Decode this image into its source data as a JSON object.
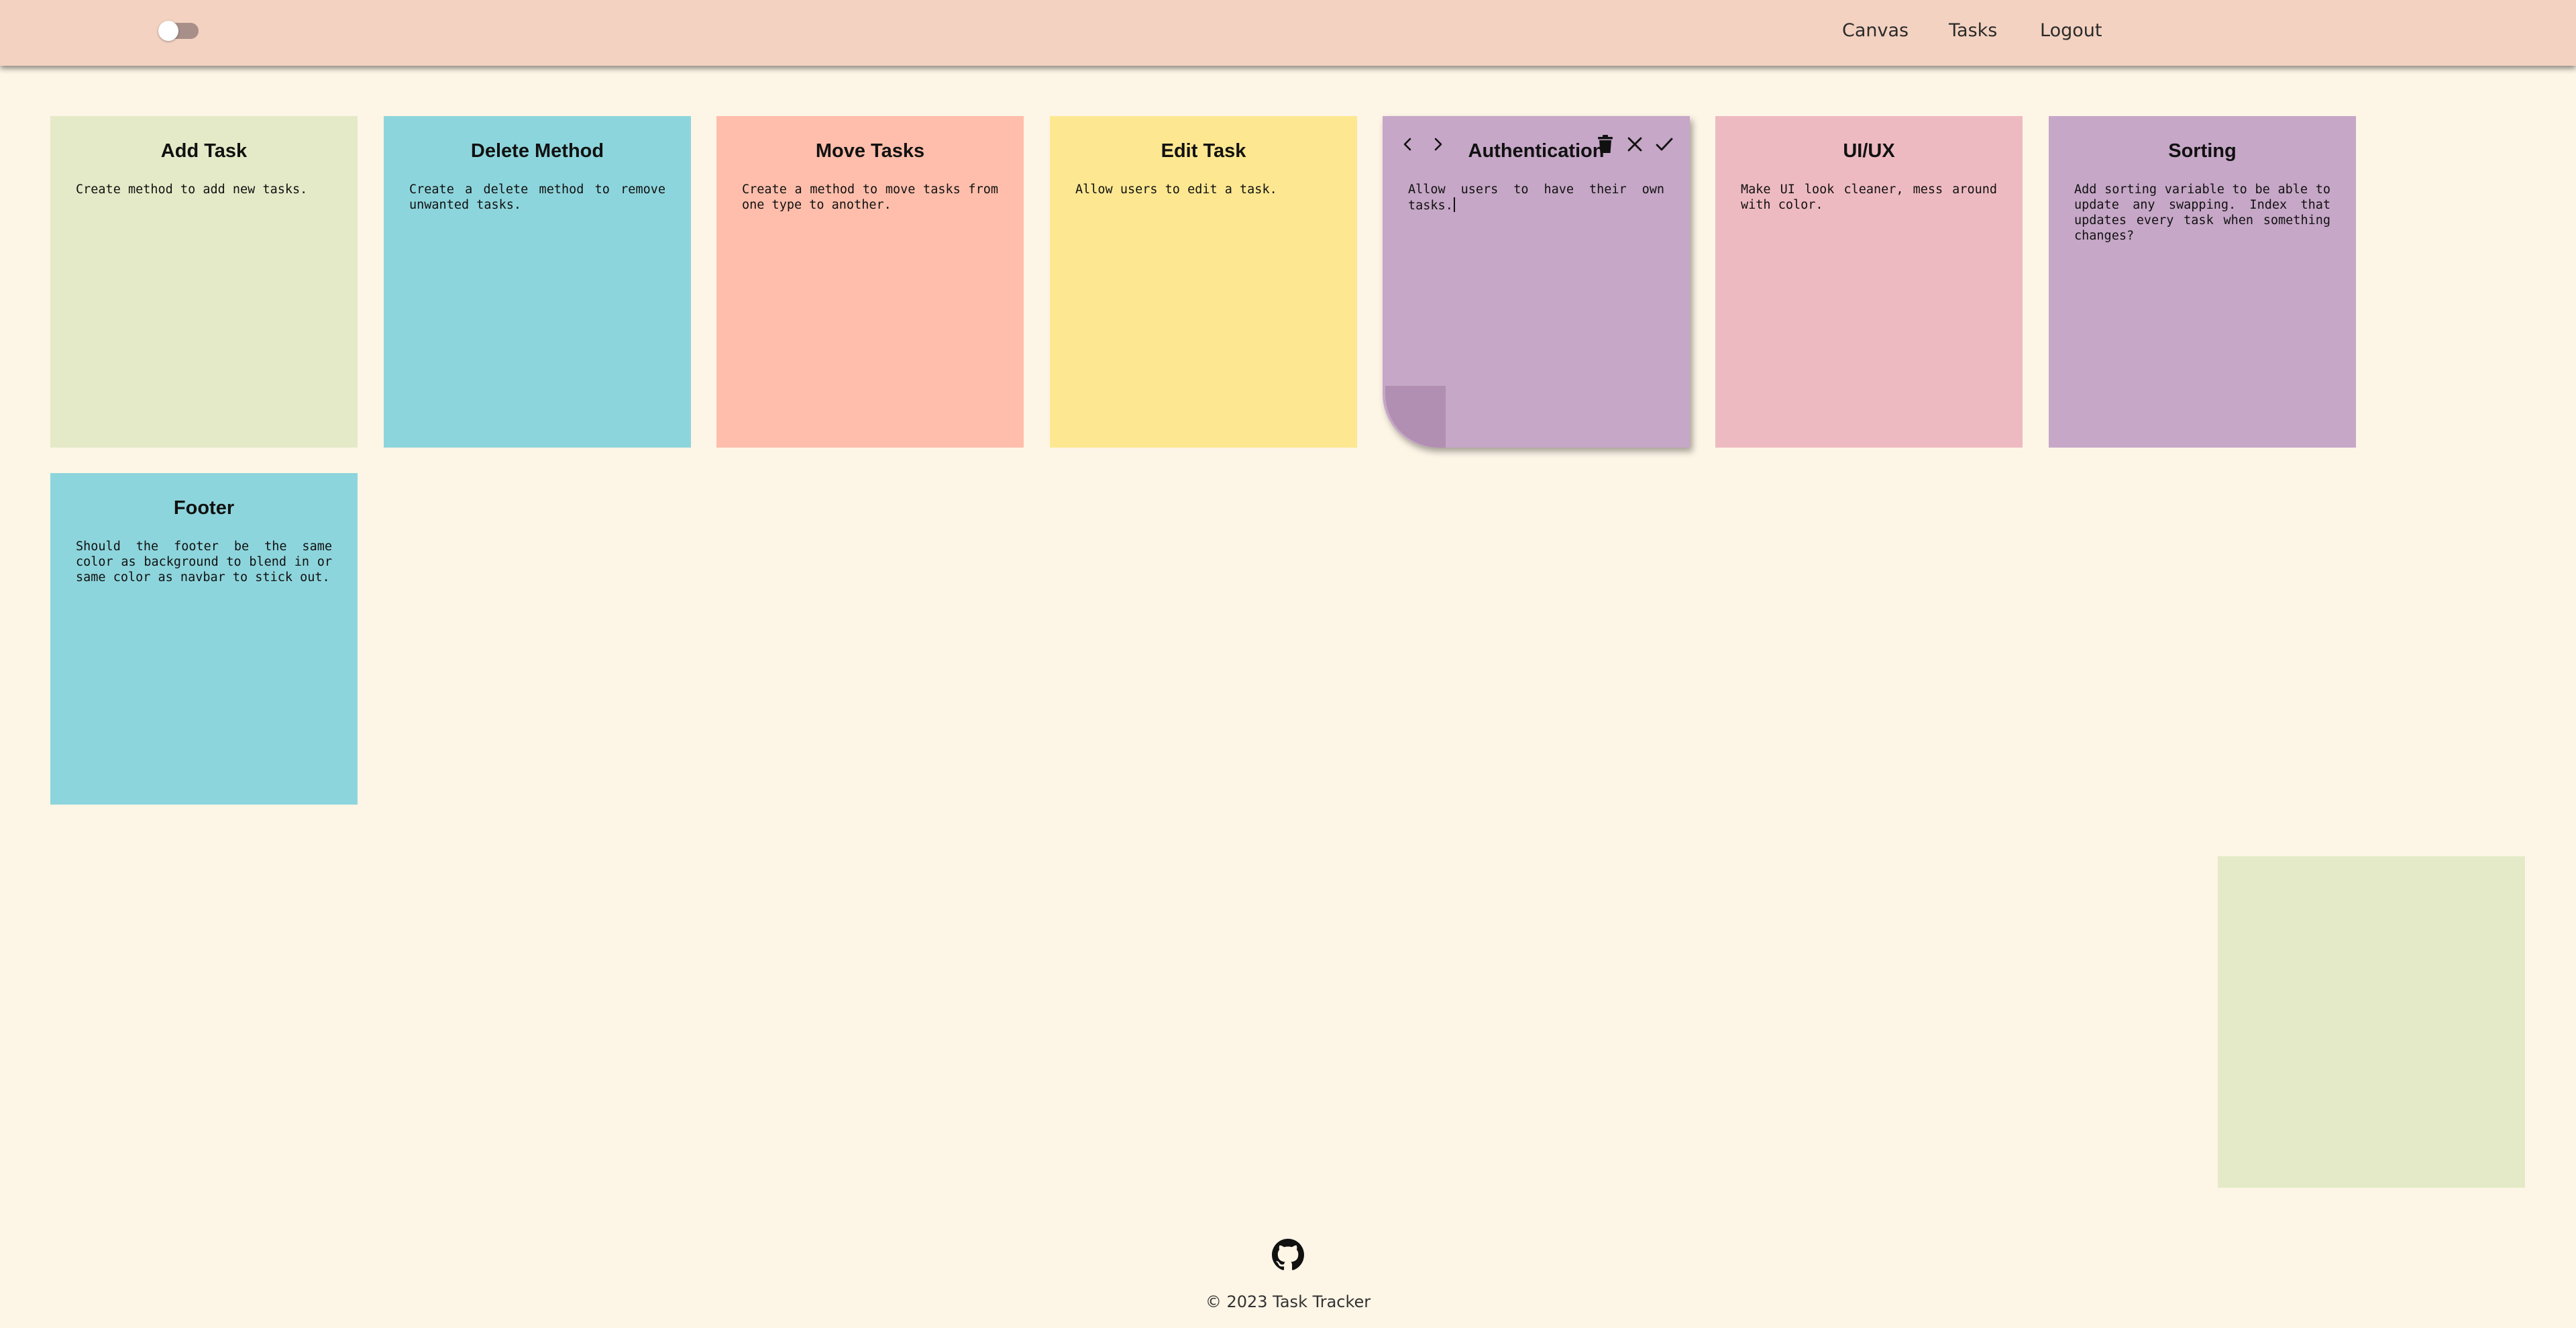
{
  "navbar": {
    "toggle_label": "",
    "links": [
      "Canvas",
      "Tasks",
      "Logout"
    ]
  },
  "cards": [
    {
      "title": "Add Task",
      "body": "Create method to add new tasks.",
      "color": "#e4eac7"
    },
    {
      "title": "Delete Method",
      "body": "Create a delete method to remove unwanted tasks.",
      "color": "#8dd5dc"
    },
    {
      "title": "Move Tasks",
      "body": "Create a method to move tasks from one type to another.",
      "color": "#ffbeab"
    },
    {
      "title": "Edit Task",
      "body": "Allow users to edit a task.",
      "color": "#fde891"
    },
    {
      "title": "Authentication",
      "body": "Allow users to have their own tasks.",
      "color": "#c6a7c7",
      "editing": true
    },
    {
      "title": "UI/UX",
      "body": "Make UI look cleaner, mess around with color.",
      "color": "#eebac1"
    },
    {
      "title": "Sorting",
      "body": "Add sorting variable to be able to update any swapping. Index that updates every task when something changes?",
      "color": "#c6a7c7"
    },
    {
      "title": "Footer",
      "body": "Should the footer be the same color as background to blend in or same color as navbar to stick out.",
      "color": "#8dd5dc"
    }
  ],
  "active_card_icons": [
    "chevron-left-icon",
    "chevron-right-icon",
    "trash-icon",
    "close-icon",
    "check-icon"
  ],
  "new_card": {
    "color": "#e4eac7"
  },
  "footer": {
    "icon": "github-icon",
    "copyright": "© 2023 Task Tracker"
  },
  "colors": {
    "background": "#fdf5e6",
    "navbar": "#f3d2c1"
  }
}
